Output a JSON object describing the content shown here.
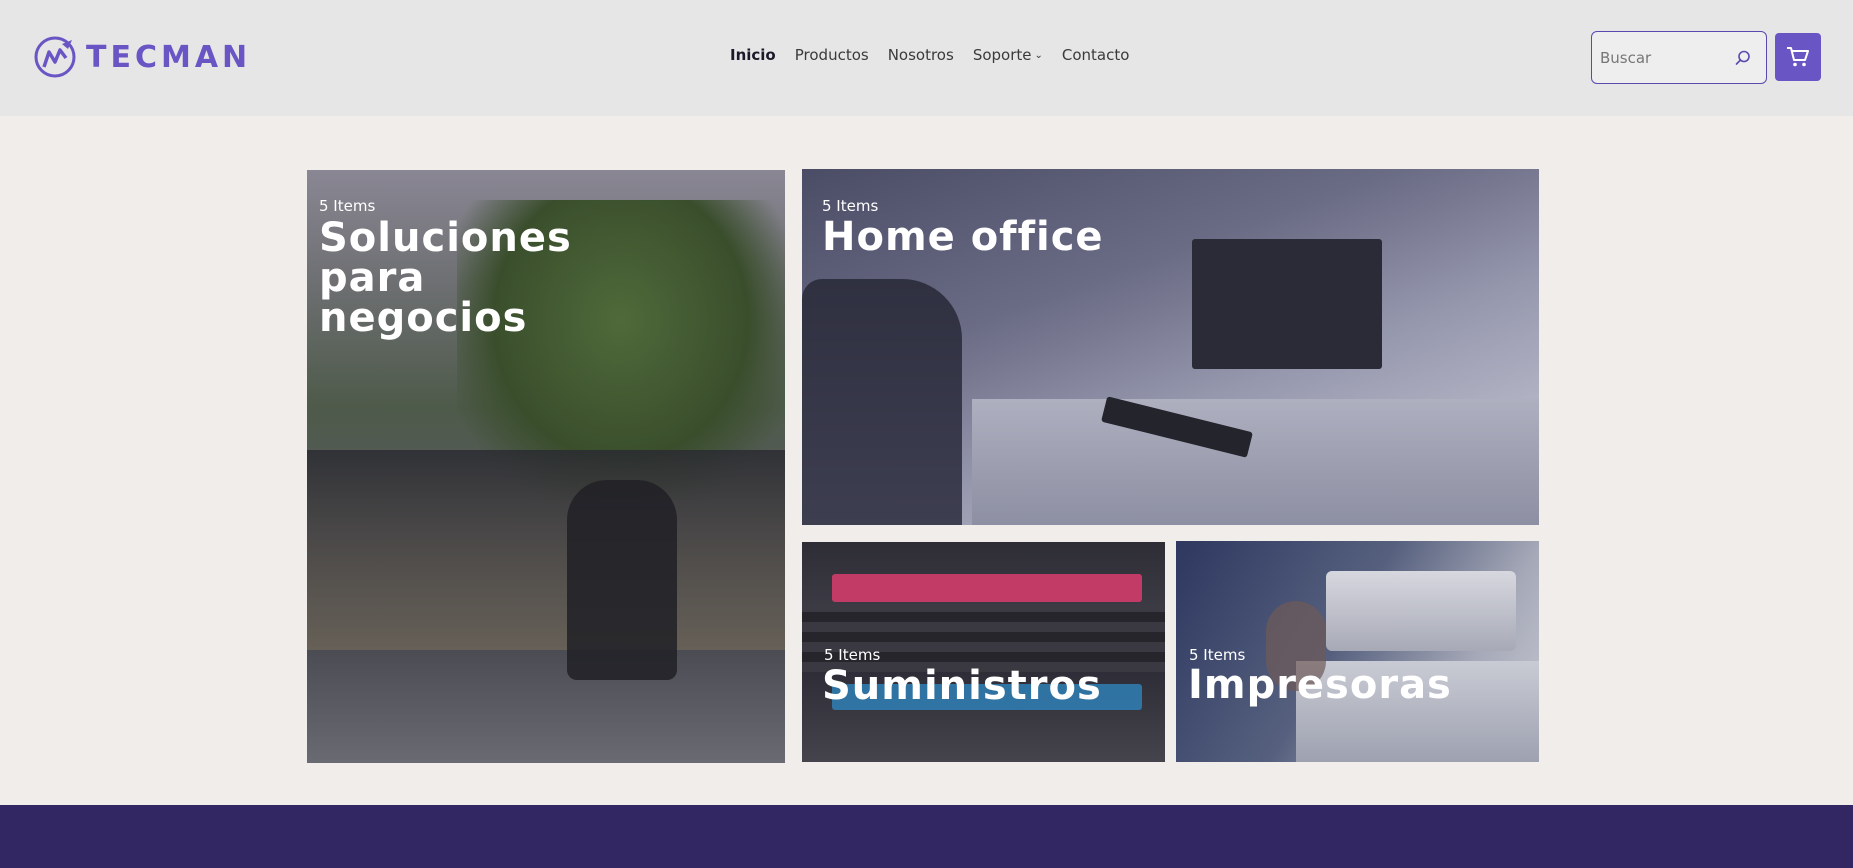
{
  "brand": {
    "name": "TECMAN",
    "accent": "#6a55c5",
    "footer_color": "#322663"
  },
  "nav": {
    "items": [
      {
        "label": "Inicio",
        "active": true
      },
      {
        "label": "Productos"
      },
      {
        "label": "Nosotros"
      },
      {
        "label": "Soporte",
        "has_dropdown": true
      },
      {
        "label": "Contacto"
      }
    ]
  },
  "search": {
    "placeholder": "Buscar",
    "icon": "search-icon"
  },
  "cart": {
    "icon": "cart-icon"
  },
  "tiles": [
    {
      "count": "5 Items",
      "title_lines": [
        "Soluciones",
        "para",
        "negocios"
      ]
    },
    {
      "count": "5 Items",
      "title": "Home office"
    },
    {
      "count": "5 Items",
      "title": "Suministros"
    },
    {
      "count": "5 Items",
      "title": "Impresoras"
    }
  ]
}
